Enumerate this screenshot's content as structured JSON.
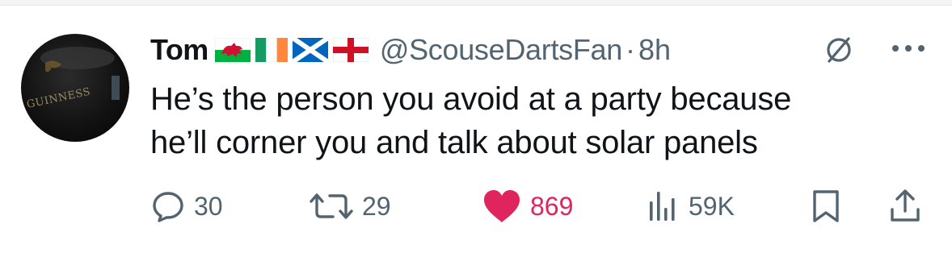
{
  "tweet": {
    "display_name": "Tom",
    "flags": [
      "wales-flag",
      "ireland-flag",
      "scotland-flag",
      "england-flag"
    ],
    "handle": "@ScouseDartsFan",
    "separator": "·",
    "time": "8h",
    "text_line1": "He’s the person you avoid at a party because",
    "text_line2": "he’ll corner you and talk about solar panels",
    "avatar_text": "GUINNESS"
  },
  "actions": {
    "replies": "30",
    "retweets": "29",
    "likes": "869",
    "views": "59K"
  },
  "colors": {
    "text": "#0f1419",
    "secondary": "#536471",
    "like": "#e0245e"
  }
}
